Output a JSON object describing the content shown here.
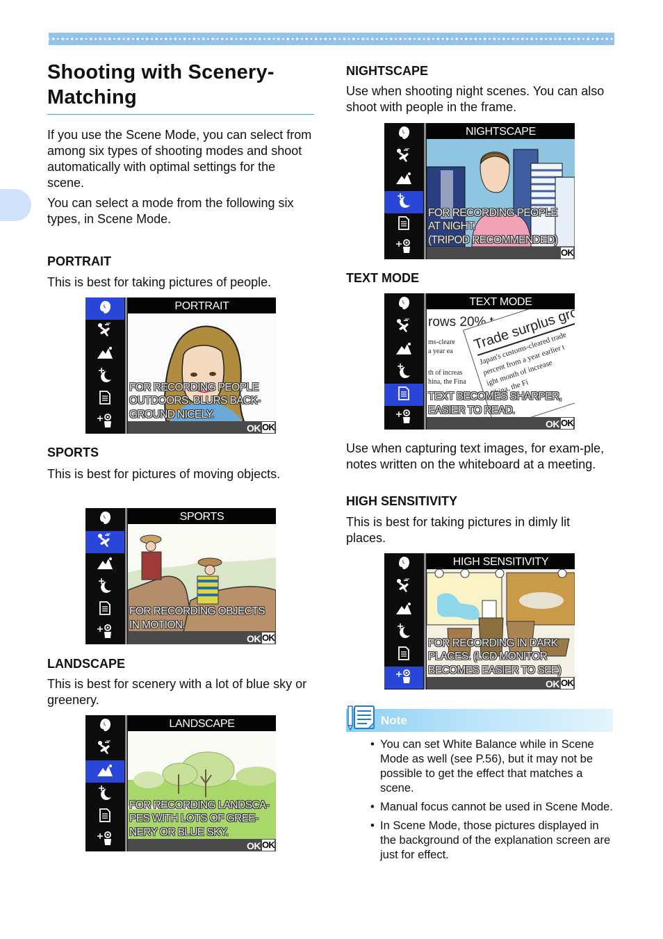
{
  "page": {
    "title": "Shooting with Scenery-Matching",
    "intro": [
      "If you use the Scene Mode, you can select from among six types of shooting modes and shoot automatically with optimal settings for the scene.",
      "You can select a mode from the following six types, in Scene Mode."
    ]
  },
  "accent_colors": {
    "stripe": "#93c3ea",
    "title_rule": "#1ea9e6",
    "side_tab": "#d0e3fb",
    "menu_selected": "#2a46d8",
    "note_header": "#8ccff3"
  },
  "menu_icons": [
    "portrait-icon",
    "sports-icon",
    "landscape-icon",
    "nightscape-icon",
    "text-mode-icon",
    "high-sensitivity-icon"
  ],
  "modes": [
    {
      "id": "portrait",
      "heading": "PORTRAIT",
      "description": "This is best for taking pictures of people.",
      "screen_title": "PORTRAIT",
      "caption": [
        "FOR RECORDING PEOPLE",
        "OUTDOORS. BLURS BACK-",
        "GROUND NICELY."
      ],
      "ok_text": "OK",
      "ok_box": "OK",
      "selected_index": 0
    },
    {
      "id": "sports",
      "heading": "SPORTS",
      "description": "This is best for pictures of moving objects.",
      "screen_title": "SPORTS",
      "caption": [
        "FOR RECORDING OBJECTS",
        "IN MOTION."
      ],
      "ok_text": "OK",
      "ok_box": "OK",
      "selected_index": 1
    },
    {
      "id": "landscape",
      "heading": "LANDSCAPE",
      "description": "This is best for scenery with a lot of blue sky or greenery.",
      "screen_title": "LANDSCAPE",
      "caption": [
        "FOR RECORDING LANDSCA-",
        "PES WITH LOTS OF GREE-",
        "NERY OR BLUE SKY."
      ],
      "ok_text": "OK",
      "ok_box": "OK",
      "selected_index": 2
    },
    {
      "id": "nightscape",
      "heading": "NIGHTSCAPE",
      "description": "Use when shooting night scenes. You can also shoot with people in the frame.",
      "screen_title": "NIGHTSCAPE",
      "caption": [
        "FOR RECORDING PEOPLE",
        "AT NIGHT.",
        "(TRIPOD RECOMMENDED)"
      ],
      "ok_text": "",
      "ok_box": "OK",
      "selected_index": 3
    },
    {
      "id": "text-mode",
      "heading": "TEXT MODE",
      "description": "Use when capturing text images, for exam-ple, notes written on the whiteboard at a meeting.",
      "screen_title": "TEXT MODE",
      "caption": [
        "TEXT BECOMES SHARPER,",
        "EASIER TO READ."
      ],
      "ok_text": "OK",
      "ok_box": "OK",
      "selected_index": 4,
      "newspaper_text": {
        "headline_back": "rows 20% t",
        "headline_front": "Trade surplus gro",
        "body_front": [
          "Japan's customs-cleared trade",
          "percent from a year earlier t",
          "ight month of increase",
          "China, the Fi"
        ],
        "body_back": [
          "ms-cleare",
          "a year ea",
          "th of increas",
          "hina, the Fina"
        ]
      }
    },
    {
      "id": "high-sensitivity",
      "heading": "HIGH SENSITIVITY",
      "description": "This is best for taking pictures in dimly lit places.",
      "screen_title": "HIGH SENSITIVITY",
      "caption": [
        "FOR RECORDING IN DARK",
        "PLACES. (LCD MONITOR",
        "BECOMES EASIER TO SEE)"
      ],
      "ok_text": "OK",
      "ok_box": "OK",
      "selected_index": 5
    }
  ],
  "note": {
    "label": "Note",
    "icon": "notepad-pencil-icon",
    "items": [
      "You can set White Balance while in Scene Mode as well (see P.56), but it may not be possible to get the effect that matches a scene.",
      "Manual focus cannot be used in Scene Mode.",
      "In Scene Mode, those pictures displayed in the background of the explanation screen are just for effect."
    ],
    "bullet": "•"
  }
}
